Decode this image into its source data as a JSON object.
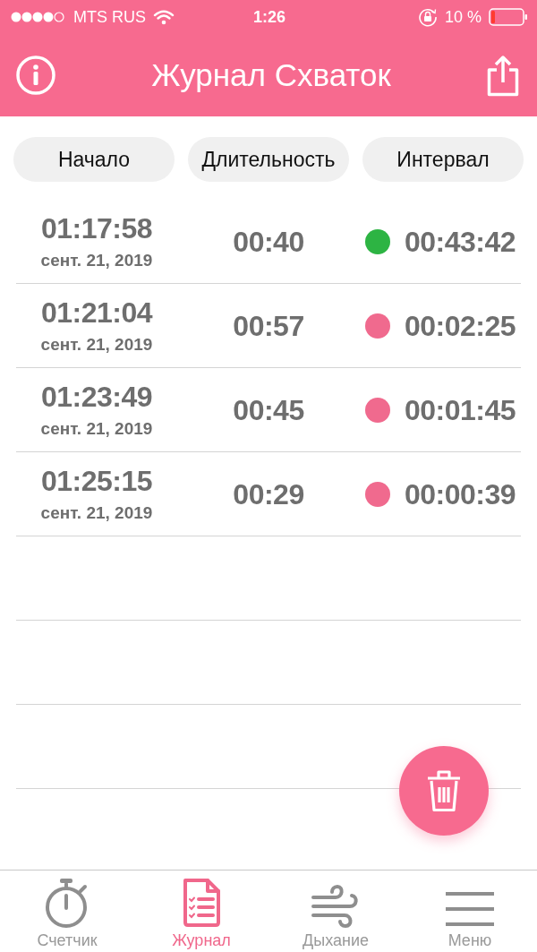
{
  "status_bar": {
    "carrier": "MTS RUS",
    "time": "1:26",
    "battery": "10 %"
  },
  "header": {
    "title": "Журнал Схваток"
  },
  "columns": [
    {
      "label": "Начало"
    },
    {
      "label": "Длительность"
    },
    {
      "label": "Интервал"
    }
  ],
  "rows": [
    {
      "start_time": "01:17:58",
      "start_date": "сент. 21, 2019",
      "duration": "00:40",
      "interval": "00:43:42",
      "color": "#2db443"
    },
    {
      "start_time": "01:21:04",
      "start_date": "сент. 21, 2019",
      "duration": "00:57",
      "interval": "00:02:25",
      "color": "#f06a8e"
    },
    {
      "start_time": "01:23:49",
      "start_date": "сент. 21, 2019",
      "duration": "00:45",
      "interval": "00:01:45",
      "color": "#f06a8e"
    },
    {
      "start_time": "01:25:15",
      "start_date": "сент. 21, 2019",
      "duration": "00:29",
      "interval": "00:00:39",
      "color": "#f06a8e"
    }
  ],
  "tabs": [
    {
      "label": "Счетчик",
      "selected": false
    },
    {
      "label": "Журнал",
      "selected": true
    },
    {
      "label": "Дыхание",
      "selected": false
    },
    {
      "label": "Меню",
      "selected": false
    }
  ]
}
